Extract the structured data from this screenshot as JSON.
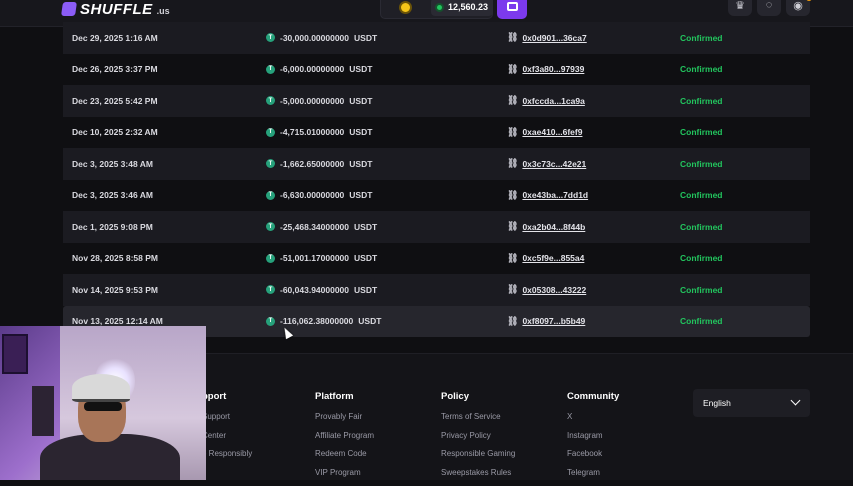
{
  "header": {
    "logo_text": "SHUFFLE",
    "logo_suffix": ".us",
    "balance": "12,560.23"
  },
  "transactions": [
    {
      "date": "Dec 29, 2025 1:16 AM",
      "amount": "-30,000.00000000",
      "currency": "USDT",
      "hash": "0x0d901...36ca7",
      "status": "Confirmed"
    },
    {
      "date": "Dec 26, 2025 3:37 PM",
      "amount": "-6,000.00000000",
      "currency": "USDT",
      "hash": "0xf3a80...97939",
      "status": "Confirmed"
    },
    {
      "date": "Dec 23, 2025 5:42 PM",
      "amount": "-5,000.00000000",
      "currency": "USDT",
      "hash": "0xfccda...1ca9a",
      "status": "Confirmed"
    },
    {
      "date": "Dec 10, 2025 2:32 AM",
      "amount": "-4,715.01000000",
      "currency": "USDT",
      "hash": "0xae410...6fef9",
      "status": "Confirmed"
    },
    {
      "date": "Dec 3, 2025 3:48 AM",
      "amount": "-1,662.65000000",
      "currency": "USDT",
      "hash": "0x3c73c...42e21",
      "status": "Confirmed"
    },
    {
      "date": "Dec 3, 2025 3:46 AM",
      "amount": "-6,630.00000000",
      "currency": "USDT",
      "hash": "0xe43ba...7dd1d",
      "status": "Confirmed"
    },
    {
      "date": "Dec 1, 2025 9:08 PM",
      "amount": "-25,468.34000000",
      "currency": "USDT",
      "hash": "0xa2b04...8f44b",
      "status": "Confirmed"
    },
    {
      "date": "Nov 28, 2025 8:58 PM",
      "amount": "-51,001.17000000",
      "currency": "USDT",
      "hash": "0xc5f9e...855a4",
      "status": "Confirmed"
    },
    {
      "date": "Nov 14, 2025 9:53 PM",
      "amount": "-60,043.94000000",
      "currency": "USDT",
      "hash": "0x05308...43222",
      "status": "Confirmed"
    },
    {
      "date": "Nov 13, 2025 12:14 AM",
      "amount": "-116,062.38000000",
      "currency": "USDT",
      "hash": "0xf8097...b5b49",
      "status": "Confirmed"
    }
  ],
  "footer": {
    "support": {
      "title": "pport",
      "links": [
        "Support",
        "Center",
        "e Responsibly"
      ]
    },
    "platform": {
      "title": "Platform",
      "links": [
        "Provably Fair",
        "Affiliate Program",
        "Redeem Code",
        "VIP Program"
      ]
    },
    "policy": {
      "title": "Policy",
      "links": [
        "Terms of Service",
        "Privacy Policy",
        "Responsible Gaming",
        "Sweepstakes Rules"
      ]
    },
    "community": {
      "title": "Community",
      "links": [
        "X",
        "Instagram",
        "Facebook",
        "Telegram"
      ]
    },
    "language": "English"
  },
  "colors": {
    "accent": "#7c3aed",
    "confirmed": "#22c55e",
    "tether": "#26a17b"
  }
}
